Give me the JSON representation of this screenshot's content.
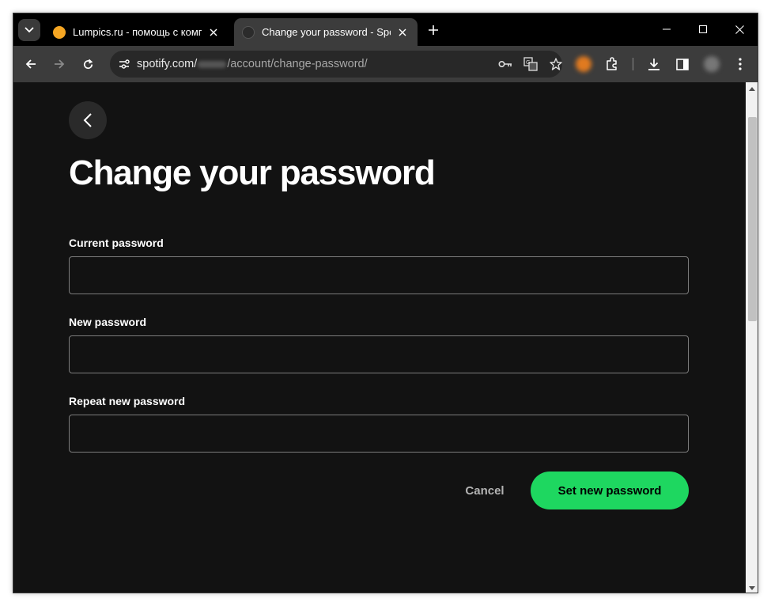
{
  "browser": {
    "tabs": [
      {
        "title": "Lumpics.ru - помощь с компью",
        "favicon_color": "#f5a623",
        "active": false
      },
      {
        "title": "Change your password - Spotify",
        "favicon_color": "#2b2b2b",
        "active": true
      }
    ],
    "url": {
      "domain": "spotify.com/",
      "path": "/account/change-password/"
    },
    "icons": [
      "tab-search-icon",
      "close-icon",
      "new-tab-icon",
      "minimize-icon",
      "maximize-icon",
      "back-icon",
      "forward-icon",
      "reload-icon",
      "site-info-icon",
      "password-key-icon",
      "translate-icon",
      "bookmark-star-icon",
      "extensions-icon",
      "download-icon",
      "side-panel-icon",
      "menu-icon"
    ]
  },
  "page": {
    "title": "Change your password",
    "fields": [
      {
        "label": "Current password",
        "value": "",
        "placeholder": ""
      },
      {
        "label": "New password",
        "value": "",
        "placeholder": ""
      },
      {
        "label": "Repeat new password",
        "value": "",
        "placeholder": ""
      }
    ],
    "cancel_label": "Cancel",
    "submit_label": "Set new password"
  },
  "colors": {
    "background": "#121212",
    "accent": "#1ed760",
    "text": "#ffffff",
    "muted": "#b3b3b3"
  }
}
